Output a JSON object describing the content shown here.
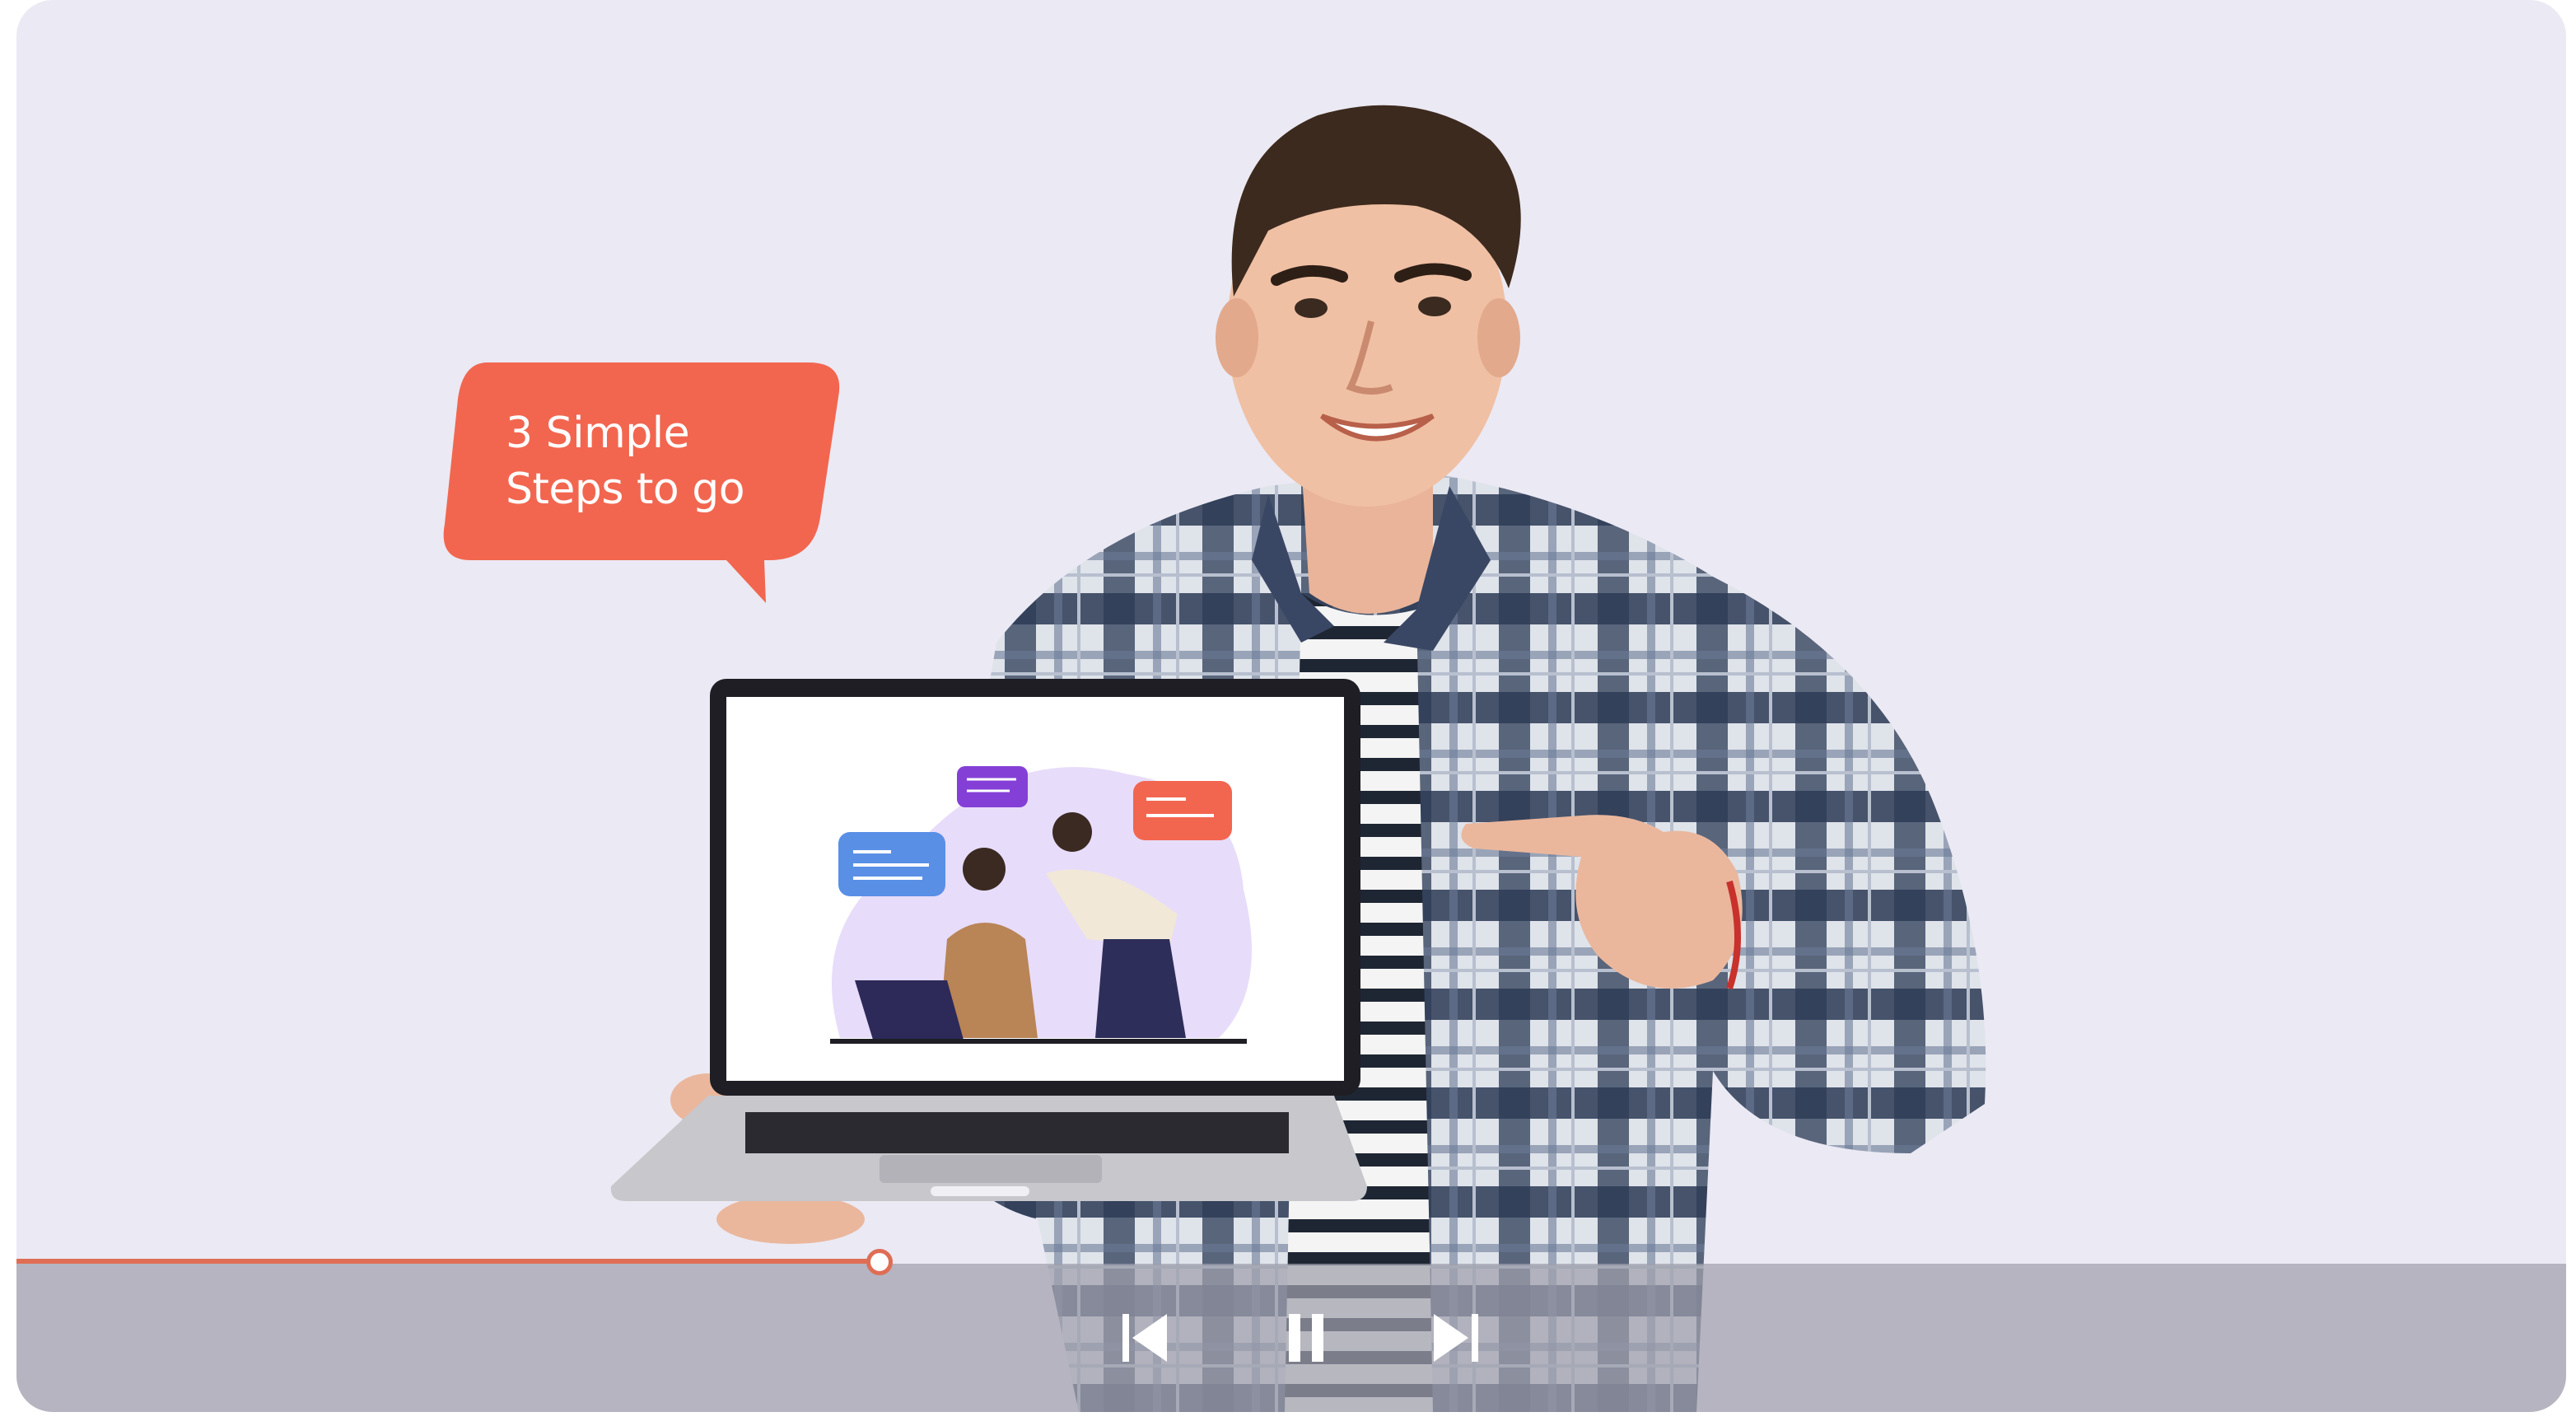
{
  "bubble": {
    "line1": "3 Simple",
    "line2": "Steps to go",
    "color": "#f26650"
  },
  "controls": {
    "progress": 0.33,
    "accent": "#df6d55",
    "prev_icon": "skip-previous-icon",
    "pause_icon": "pause-icon",
    "next_icon": "skip-next-icon"
  },
  "colors": {
    "background": "#ebe9f3",
    "bar": "#a0a0ac"
  }
}
